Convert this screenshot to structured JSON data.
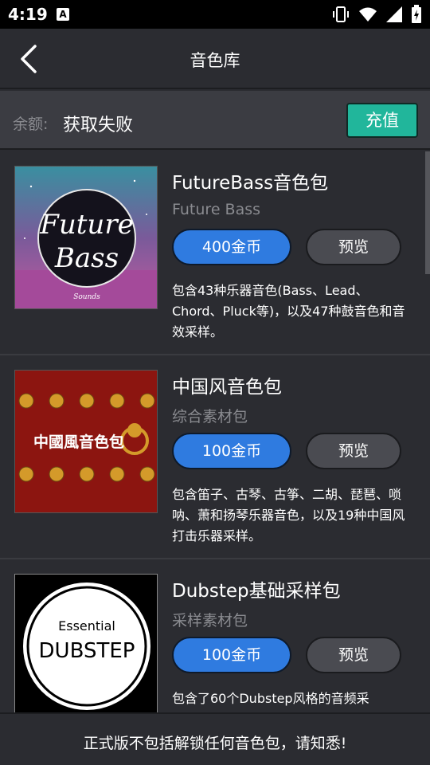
{
  "status_bar": {
    "time": "4:19",
    "app_letter": "A"
  },
  "header": {
    "title": "音色库",
    "back_icon": "chevron-left-icon"
  },
  "balance": {
    "label": "余额:",
    "value": "获取失败",
    "recharge_label": "充值",
    "recharge_color": "#21b69b"
  },
  "packs": [
    {
      "name": "FutureBass音色包",
      "subtitle": "Future Bass",
      "price_label": "400金币",
      "preview_label": "预览",
      "description": "包含43种乐器音色(Bass、Lead、Chord、Pluck等)，以及47种鼓音色和音效采样。",
      "cover": {
        "line1": "Future",
        "line2": "Bass",
        "line3": "Sounds"
      }
    },
    {
      "name": "中国风音色包",
      "subtitle": "综合素材包",
      "price_label": "100金币",
      "preview_label": "预览",
      "description": "包含笛子、古琴、古筝、二胡、琵琶、唢呐、萧和扬琴乐器音色，以及19种中国风打击乐器采样。",
      "cover": {
        "text": "中國風音色包"
      }
    },
    {
      "name": "Dubstep基础采样包",
      "subtitle": "采样素材包",
      "price_label": "100金币",
      "preview_label": "预览",
      "description": "包含了60个Dubstep风格的音频采",
      "cover": {
        "line1": "Essential",
        "line2": "DUBSTEP"
      }
    }
  ],
  "footer": {
    "notice": "正式版不包括解锁任何音色包，请知悉!"
  },
  "colors": {
    "accent_blue": "#2f7be0",
    "background": "#2b2c31"
  }
}
